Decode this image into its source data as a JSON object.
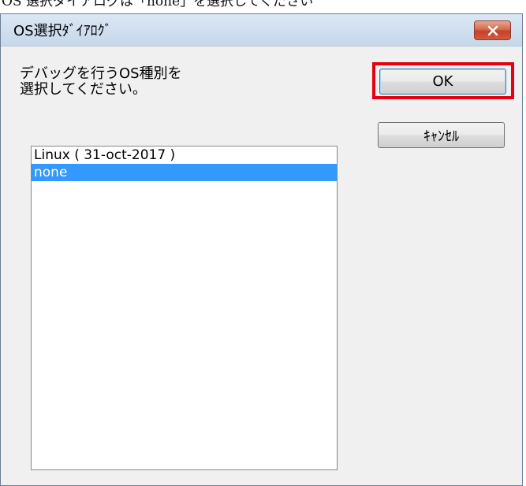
{
  "caption": {
    "text": "OS 選択ダイアログは「none」を選択してください"
  },
  "dialog": {
    "title": "OS選択ﾀﾞｲｱﾛｸﾞ",
    "close_icon": "close-x-icon",
    "prompt_line1": "デバッグを行うOS種別を",
    "prompt_line2": "選択してください。",
    "ok_label": "OK",
    "cancel_label": "ｷｬﾝｾﾙ",
    "highlight_color": "#e60012",
    "list": {
      "items": [
        {
          "label": "Linux ( 31-oct-2017 )",
          "selected": false
        },
        {
          "label": "none",
          "selected": true
        }
      ],
      "selection_color": "#3399ff"
    }
  }
}
